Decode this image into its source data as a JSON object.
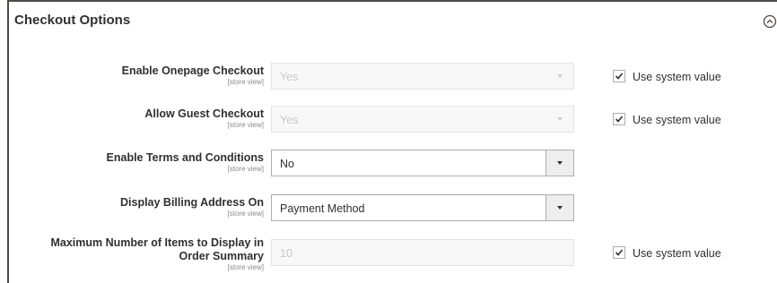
{
  "section": {
    "title": "Checkout Options"
  },
  "fields": [
    {
      "label": "Enable Onepage Checkout",
      "scope": "[store view]",
      "value": "Yes",
      "disabled": true,
      "use_system_label": "Use system value",
      "use_system_checked": true
    },
    {
      "label": "Allow Guest Checkout",
      "scope": "[store view]",
      "value": "Yes",
      "disabled": true,
      "use_system_label": "Use system value",
      "use_system_checked": true
    },
    {
      "label": "Enable Terms and Conditions",
      "scope": "[store view]",
      "value": "No",
      "disabled": false
    },
    {
      "label": "Display Billing Address On",
      "scope": "[store view]",
      "value": "Payment Method",
      "disabled": false
    },
    {
      "label_line1": "Maximum Number of Items to Display in",
      "label_line2": "Order Summary",
      "scope": "[store view]",
      "value": "10",
      "disabled": true,
      "use_system_label": "Use system value",
      "use_system_checked": true
    }
  ],
  "icons": {
    "collapse": "chevron-up-circle-icon",
    "dropdown": "chevron-down-icon",
    "checkbox": "checkmark-icon"
  },
  "colors": {
    "border": "#adadad",
    "disabled_text": "#c8c8c8",
    "text": "#303030"
  }
}
